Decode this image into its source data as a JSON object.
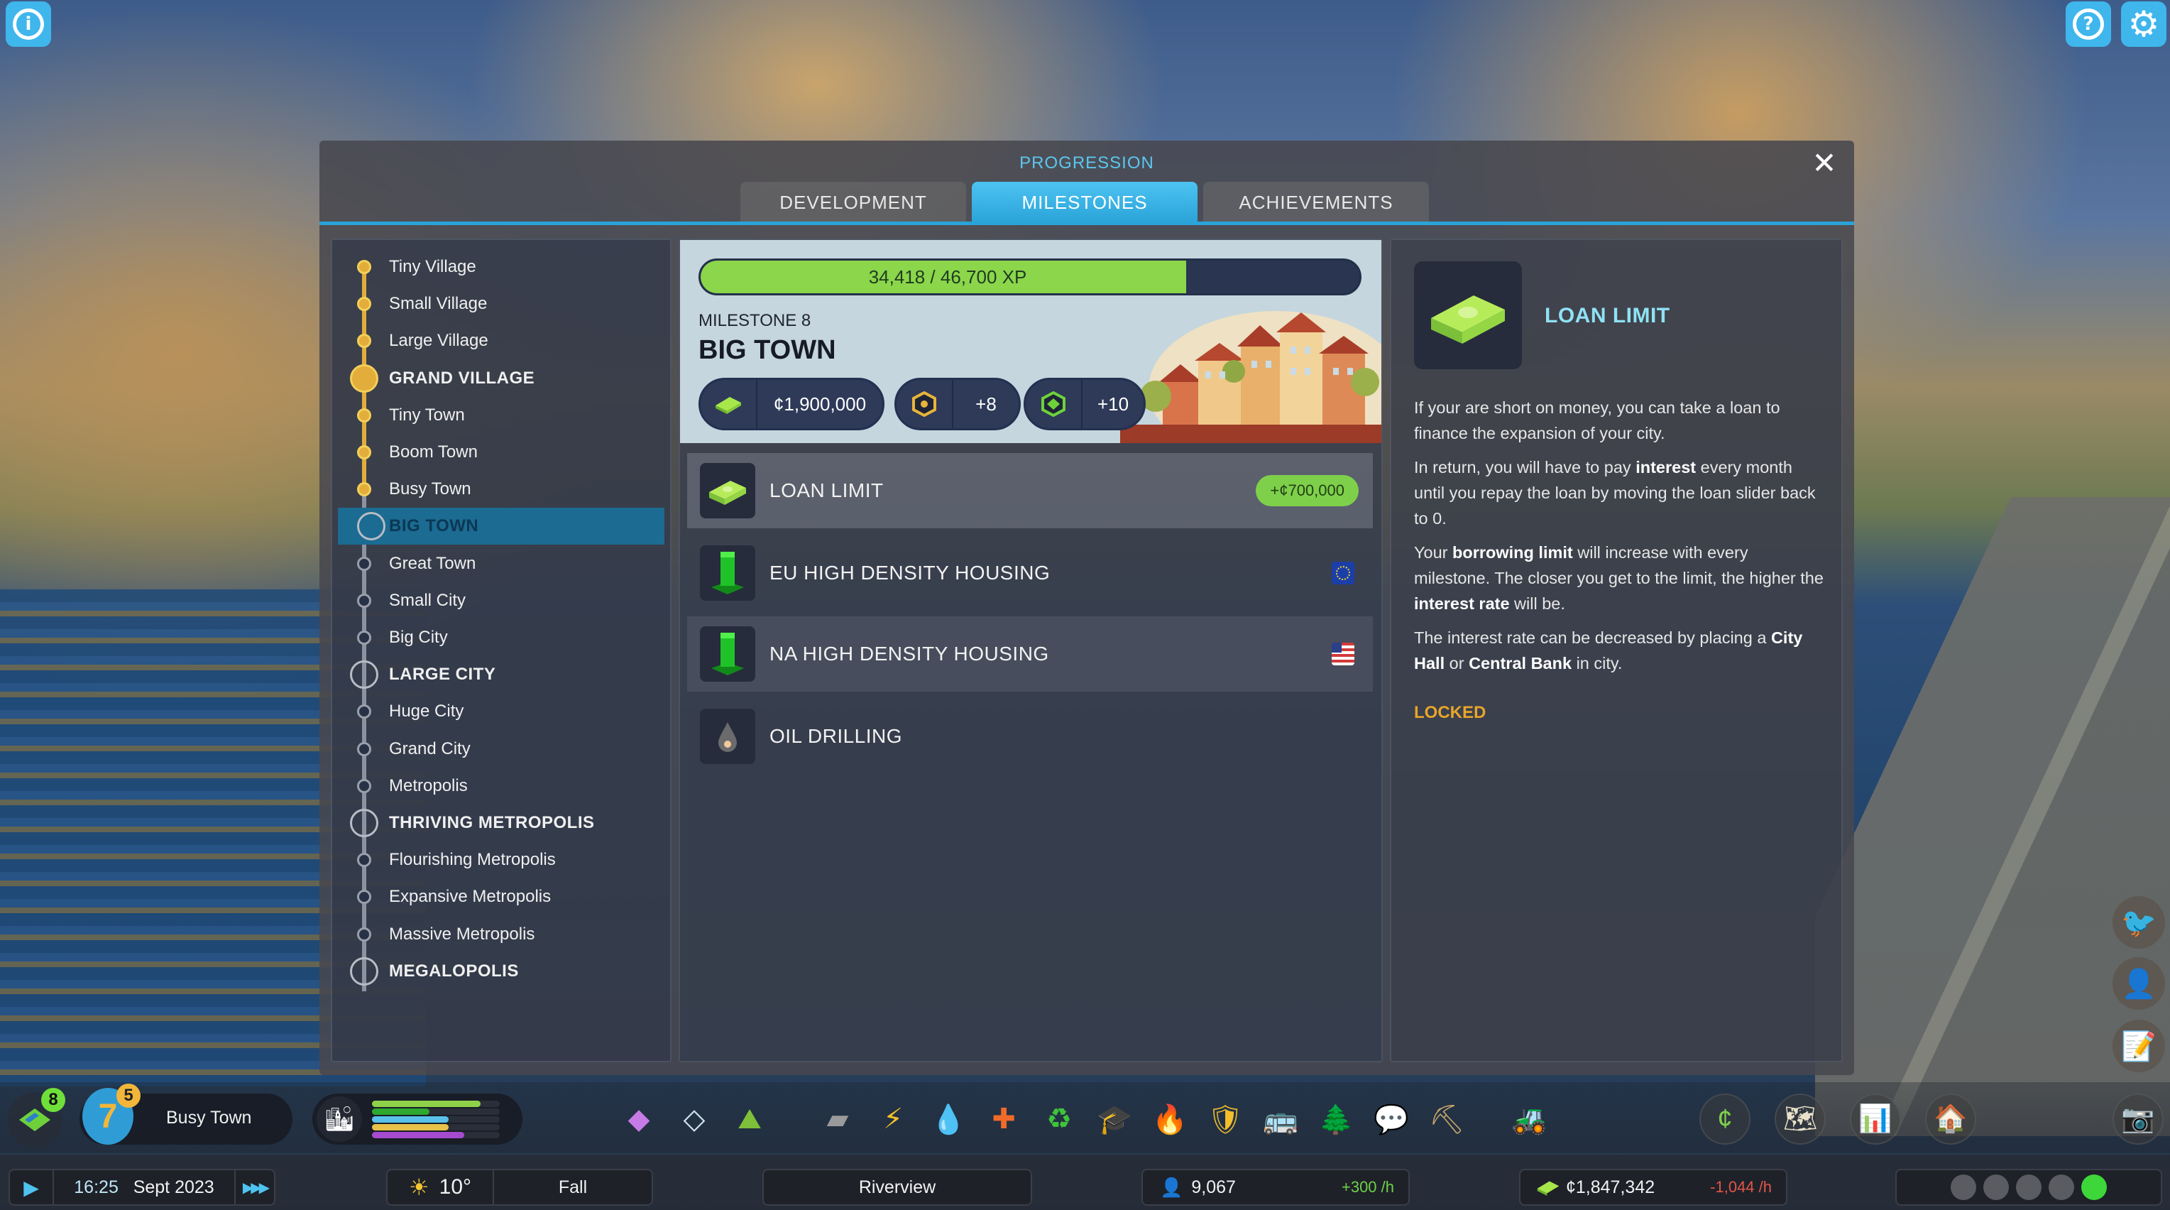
{
  "window": {
    "title": "Progression"
  },
  "corner_buttons": {
    "info": {
      "icon": "info-icon"
    },
    "help": {
      "icon": "help-icon"
    },
    "settings": {
      "icon": "gear-icon"
    }
  },
  "panel": {
    "title": "PROGRESSION",
    "tabs": [
      {
        "label": "DEVELOPMENT",
        "active": false
      },
      {
        "label": "MILESTONES",
        "active": true
      },
      {
        "label": "ACHIEVEMENTS",
        "active": false
      }
    ],
    "close_icon": "✕"
  },
  "milestones": [
    {
      "label": "Tiny Village",
      "major": false,
      "done": true
    },
    {
      "label": "Small Village",
      "major": false,
      "done": true
    },
    {
      "label": "Large Village",
      "major": false,
      "done": true
    },
    {
      "label": "GRAND VILLAGE",
      "major": true,
      "done": true
    },
    {
      "label": "Tiny Town",
      "major": false,
      "done": true
    },
    {
      "label": "Boom Town",
      "major": false,
      "done": true
    },
    {
      "label": "Busy Town",
      "major": false,
      "done": true
    },
    {
      "label": "BIG TOWN",
      "major": true,
      "done": false,
      "selected": true
    },
    {
      "label": "Great Town",
      "major": false,
      "done": false
    },
    {
      "label": "Small City",
      "major": false,
      "done": false
    },
    {
      "label": "Big City",
      "major": false,
      "done": false
    },
    {
      "label": "LARGE CITY",
      "major": true,
      "done": false
    },
    {
      "label": "Huge City",
      "major": false,
      "done": false
    },
    {
      "label": "Grand City",
      "major": false,
      "done": false
    },
    {
      "label": "Metropolis",
      "major": false,
      "done": false
    },
    {
      "label": "THRIVING METROPOLIS",
      "major": true,
      "done": false
    },
    {
      "label": "Flourishing Metropolis",
      "major": false,
      "done": false
    },
    {
      "label": "Expansive Metropolis",
      "major": false,
      "done": false
    },
    {
      "label": "Massive Metropolis",
      "major": false,
      "done": false
    },
    {
      "label": "MEGALOPOLIS",
      "major": true,
      "done": false
    }
  ],
  "milestone_detail": {
    "xp_text": "34,418 / 46,700 XP",
    "xp_current": 34418,
    "xp_total": 46700,
    "number_label": "MILESTONE 8",
    "name": "BIG TOWN",
    "rewards": [
      {
        "icon": "money-icon",
        "value": "¢1,900,000"
      },
      {
        "icon": "development-point-icon",
        "value": "+8"
      },
      {
        "icon": "map-tile-icon",
        "value": "+10"
      }
    ],
    "unlocks": [
      {
        "icon": "money-stack-icon",
        "label": "LOAN LIMIT",
        "badge": "+¢700,000"
      },
      {
        "icon": "high-density-building-icon",
        "label": "EU HIGH DENSITY HOUSING",
        "region": "eu-flag-icon"
      },
      {
        "icon": "high-density-building-icon",
        "label": "NA HIGH DENSITY HOUSING",
        "region": "us-flag-icon"
      },
      {
        "icon": "oil-drop-icon",
        "label": "OIL DRILLING"
      }
    ]
  },
  "detail": {
    "title": "LOAN LIMIT",
    "paragraphs": [
      [
        {
          "t": "If your are short on money, you can take a loan to finance the expansion of your city."
        }
      ],
      [
        {
          "t": "In return, you will have to pay "
        },
        {
          "t": "interest",
          "b": true
        },
        {
          "t": " every month until you repay the loan by moving the loan slider back to 0."
        }
      ],
      [
        {
          "t": "Your "
        },
        {
          "t": "borrowing limit",
          "b": true
        },
        {
          "t": " will increase with every milestone. The closer you get to the limit, the higher the "
        },
        {
          "t": "interest rate",
          "b": true
        },
        {
          "t": " will be."
        }
      ],
      [
        {
          "t": "The interest rate can be decreased by placing a "
        },
        {
          "t": "City Hall",
          "b": true
        },
        {
          "t": " or "
        },
        {
          "t": "Central Bank",
          "b": true
        },
        {
          "t": " in city."
        }
      ]
    ],
    "status": "LOCKED"
  },
  "hud": {
    "tiles_badge": "8",
    "milestone_level": "7",
    "milestone_badge": "5",
    "milestone_name": "Busy Town",
    "demand_bars": [
      {
        "name": "residential-low",
        "color": "#8fd24a",
        "level": 0.85
      },
      {
        "name": "residential-high",
        "color": "#2ea82e",
        "level": 0.45
      },
      {
        "name": "commercial",
        "color": "#5ac2ea",
        "level": 0.6
      },
      {
        "name": "industrial",
        "color": "#e8c24a",
        "level": 0.6
      },
      {
        "name": "office",
        "color": "#a54bd0",
        "level": 0.72
      }
    ],
    "time": "16:25",
    "date": "Sept 2023",
    "temperature": "10°",
    "season": "Fall",
    "city_name": "Riverview",
    "population": "9,067",
    "population_rate": "+300 /h",
    "money": "¢1,847,342",
    "money_rate": "-1,044 /h",
    "tools": [
      "zoning-icon",
      "area-icon",
      "terrain-icon",
      "roads-icon",
      "electricity-icon",
      "water-icon",
      "healthcare-icon",
      "garbage-icon",
      "education-icon",
      "fire-icon",
      "police-icon",
      "transport-icon",
      "parks-icon",
      "communications-icon",
      "landscaping-icon",
      "bulldozer-icon"
    ],
    "right_tools": [
      "economy-icon",
      "map-icon",
      "statistics-icon",
      "progression-icon"
    ],
    "happiness_levels": 5,
    "happiness_active": 5,
    "colors": {
      "positive": "#6fd14a",
      "negative": "#e2554a",
      "accent": "#2aa3d8",
      "locked": "#e8a52a"
    }
  }
}
